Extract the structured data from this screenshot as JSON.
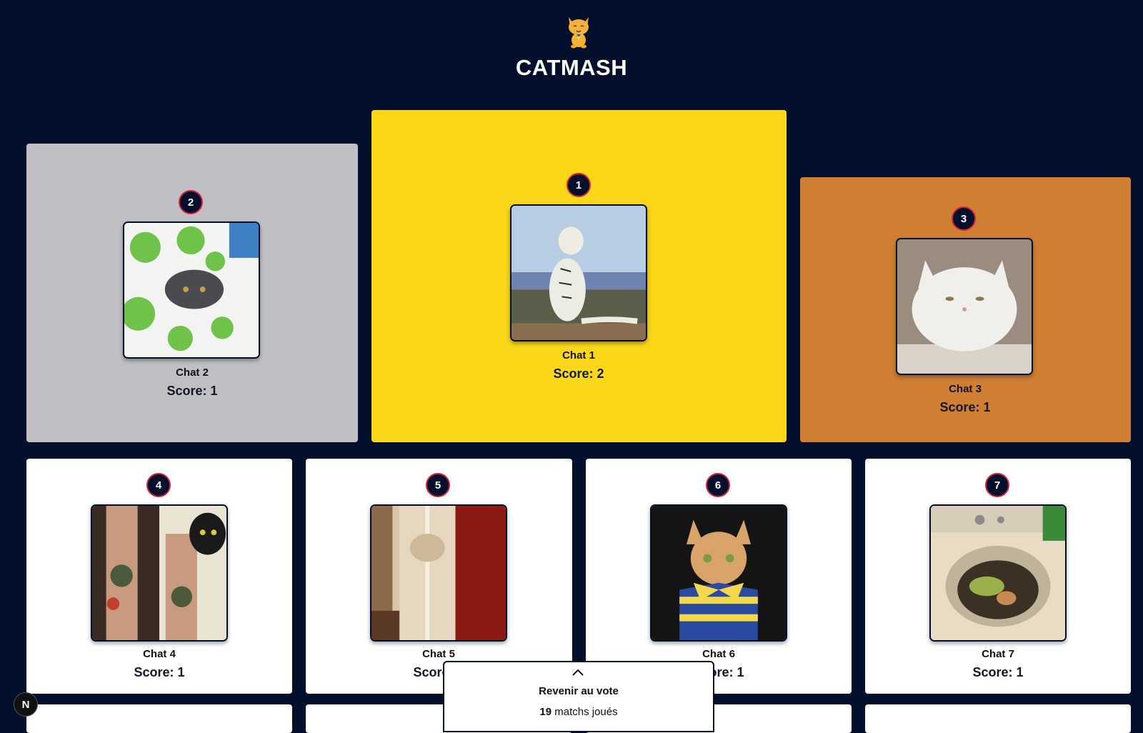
{
  "app": {
    "title": "CATMASH",
    "logo_icon": "cat-logo-icon"
  },
  "podium": [
    {
      "rank": "2",
      "name": "Chat 2",
      "score": "Score: 1",
      "bg": "#c0c0c4"
    },
    {
      "rank": "1",
      "name": "Chat 1",
      "score": "Score: 2",
      "bg": "#fbd71a"
    },
    {
      "rank": "3",
      "name": "Chat 3",
      "score": "Score: 1",
      "bg": "#d07f32"
    }
  ],
  "ranking": [
    {
      "rank": "4",
      "name": "Chat 4",
      "score": "Score: 1"
    },
    {
      "rank": "5",
      "name": "Chat 5",
      "score": "Score: 1"
    },
    {
      "rank": "6",
      "name": "Chat 6",
      "score": "Score: 1"
    },
    {
      "rank": "7",
      "name": "Chat 7",
      "score": "Score: 1"
    }
  ],
  "vote_panel": {
    "label": "Revenir au vote",
    "matches_count": "19",
    "matches_suffix": " matchs joués",
    "chevron_icon": "chevron-up-icon"
  },
  "dev_badge": {
    "label": "N",
    "icon": "nextjs-icon"
  },
  "colors": {
    "background": "#03102d",
    "gold": "#fbd71a",
    "silver": "#c0c0c4",
    "bronze": "#d07f32",
    "rank_border": "#d9203a"
  }
}
